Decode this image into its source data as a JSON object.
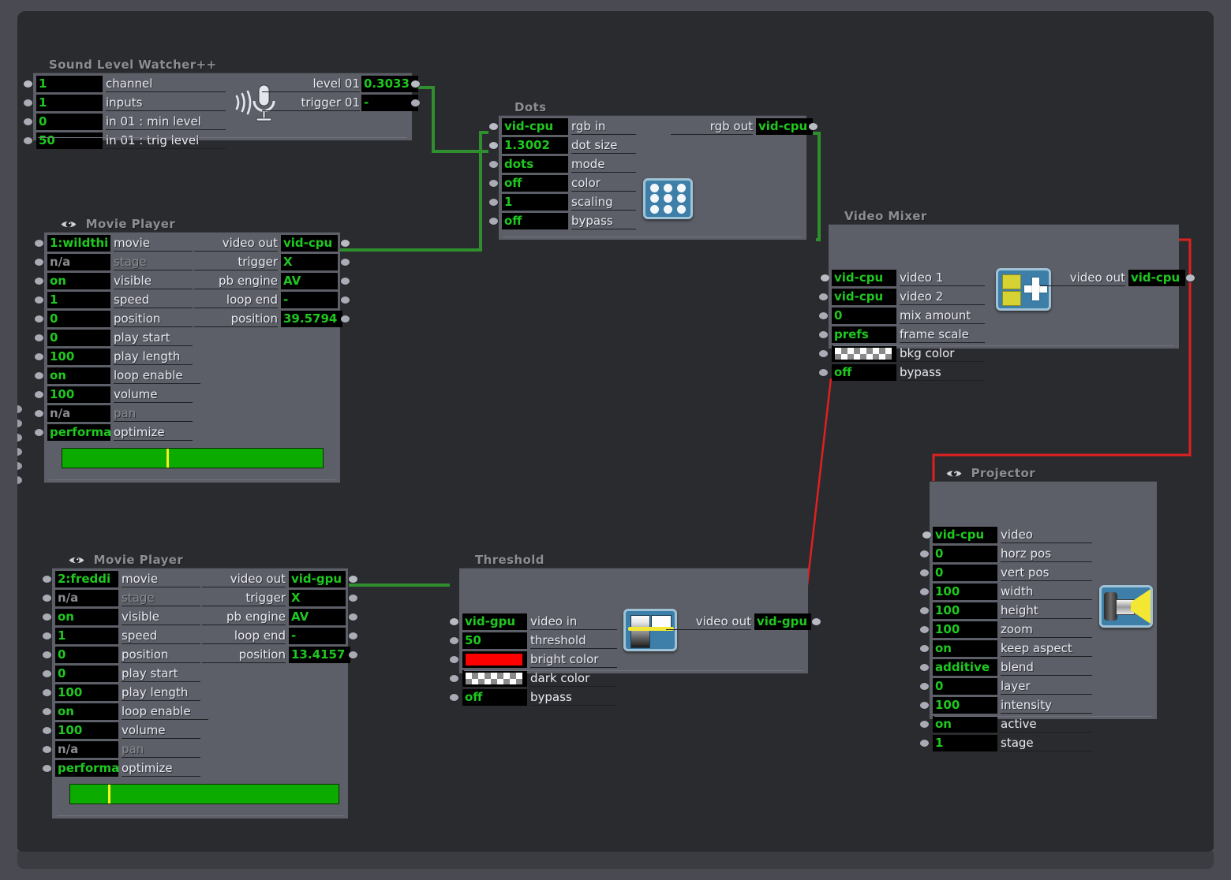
{
  "window": {
    "canvas_bg": "#2a2b2e",
    "frame_bg": "#4a4b52",
    "accent_green": "#1fc81f",
    "wire_green": "#2f8f2f",
    "wire_red": "#e02020"
  },
  "nodes": [
    {
      "id": "sound-level-watcher",
      "title": "Sound Level Watcher++",
      "icon": "microphone-icon",
      "has_eye": false,
      "inputs": [
        {
          "value": "1",
          "label": "channel"
        },
        {
          "value": "1",
          "label": "inputs"
        },
        {
          "value": "0",
          "label": "in 01 : min level"
        },
        {
          "value": "50",
          "label": "in 01 : trig level"
        }
      ],
      "outputs": [
        {
          "label": "level 01",
          "value": "0.3033",
          "connected": true
        },
        {
          "label": "trigger 01",
          "value": "-",
          "connected": false
        }
      ]
    },
    {
      "id": "dots",
      "title": "Dots",
      "icon": "dots-grid-icon",
      "has_eye": false,
      "inputs": [
        {
          "value": "vid-cpu",
          "label": "rgb in",
          "connected": true
        },
        {
          "value": "1.3002",
          "label": "dot size",
          "connected": true
        },
        {
          "value": "dots",
          "label": "mode"
        },
        {
          "value": "off",
          "label": "color"
        },
        {
          "value": "1",
          "label": "scaling"
        },
        {
          "value": "off",
          "label": "bypass"
        }
      ],
      "outputs": [
        {
          "label": "rgb out",
          "value": "vid-cpu",
          "connected": true
        }
      ]
    },
    {
      "id": "movie-player-1",
      "title": "Movie Player",
      "icon": "eye-icon",
      "has_eye": true,
      "inputs": [
        {
          "value": "1:wildthi",
          "label": "movie"
        },
        {
          "value": "n/a",
          "label": "stage",
          "dim": true
        },
        {
          "value": "on",
          "label": "visible"
        },
        {
          "value": "1",
          "label": "speed"
        },
        {
          "value": "0",
          "label": "position"
        },
        {
          "value": "0",
          "label": "play start"
        },
        {
          "value": "100",
          "label": "play length"
        },
        {
          "value": "on",
          "label": "loop enable"
        },
        {
          "value": "100",
          "label": "volume"
        },
        {
          "value": "n/a",
          "label": "pan",
          "dim": true
        },
        {
          "value": "performa",
          "label": "optimize"
        }
      ],
      "outputs": [
        {
          "label": "video out",
          "value": "vid-cpu",
          "connected": true
        },
        {
          "label": "trigger",
          "value": "X"
        },
        {
          "label": "pb engine",
          "value": "AV"
        },
        {
          "label": "loop end",
          "value": "-"
        },
        {
          "label": "position",
          "value": "39.5794"
        }
      ],
      "progress_percent": 40
    },
    {
      "id": "video-mixer",
      "title": "Video Mixer",
      "icon": "mixer-icon",
      "has_eye": false,
      "inputs": [
        {
          "value": "vid-cpu",
          "label": "video 1",
          "connected": true
        },
        {
          "value": "vid-cpu",
          "label": "video 2"
        },
        {
          "value": "0",
          "label": "mix amount"
        },
        {
          "value": "prefs",
          "label": "frame scale"
        },
        {
          "value": "",
          "label": "bkg color",
          "swatch": "checker"
        },
        {
          "value": "off",
          "label": "bypass"
        }
      ],
      "outputs": [
        {
          "label": "video out",
          "value": "vid-cpu",
          "connected": true
        }
      ]
    },
    {
      "id": "movie-player-2",
      "title": "Movie Player",
      "icon": "eye-icon",
      "has_eye": true,
      "inputs": [
        {
          "value": "2:freddi",
          "label": "movie"
        },
        {
          "value": "n/a",
          "label": "stage",
          "dim": true
        },
        {
          "value": "on",
          "label": "visible"
        },
        {
          "value": "1",
          "label": "speed"
        },
        {
          "value": "0",
          "label": "position"
        },
        {
          "value": "0",
          "label": "play start"
        },
        {
          "value": "100",
          "label": "play length"
        },
        {
          "value": "on",
          "label": "loop enable"
        },
        {
          "value": "100",
          "label": "volume"
        },
        {
          "value": "n/a",
          "label": "pan",
          "dim": true
        },
        {
          "value": "performa",
          "label": "optimize"
        }
      ],
      "outputs": [
        {
          "label": "video out",
          "value": "vid-gpu",
          "connected": true
        },
        {
          "label": "trigger",
          "value": "X"
        },
        {
          "label": "pb engine",
          "value": "AV"
        },
        {
          "label": "loop end",
          "value": "-"
        },
        {
          "label": "position",
          "value": "13.4157"
        }
      ],
      "progress_percent": 14
    },
    {
      "id": "threshold",
      "title": "Threshold",
      "icon": "threshold-icon",
      "has_eye": false,
      "inputs": [
        {
          "value": "vid-gpu",
          "label": "video in",
          "connected": true
        },
        {
          "value": "50",
          "label": "threshold"
        },
        {
          "value": "",
          "label": "bright color",
          "swatch": "red"
        },
        {
          "value": "",
          "label": "dark color",
          "swatch": "checker"
        },
        {
          "value": "off",
          "label": "bypass"
        }
      ],
      "outputs": [
        {
          "label": "video out",
          "value": "vid-gpu",
          "connected": true
        }
      ]
    },
    {
      "id": "projector",
      "title": "Projector",
      "icon": "projector-icon",
      "has_eye": true,
      "inputs": [
        {
          "value": "vid-cpu",
          "label": "video",
          "connected": true
        },
        {
          "value": "0",
          "label": "horz pos"
        },
        {
          "value": "0",
          "label": "vert pos"
        },
        {
          "value": "100",
          "label": "width"
        },
        {
          "value": "100",
          "label": "height"
        },
        {
          "value": "100",
          "label": "zoom"
        },
        {
          "value": "on",
          "label": "keep aspect"
        },
        {
          "value": "additive",
          "label": "blend"
        },
        {
          "value": "0",
          "label": "layer"
        },
        {
          "value": "100",
          "label": "intensity"
        },
        {
          "value": "on",
          "label": "active"
        },
        {
          "value": "1",
          "label": "stage"
        }
      ],
      "outputs": []
    }
  ],
  "connections": [
    {
      "from": "sound-level-watcher.level 01",
      "to": "dots.dot size",
      "color": "green"
    },
    {
      "from": "movie-player-1.video out",
      "to": "dots.rgb in",
      "color": "green"
    },
    {
      "from": "dots.rgb out",
      "to": "video-mixer.video 1",
      "color": "green"
    },
    {
      "from": "movie-player-2.video out",
      "to": "threshold.video in",
      "color": "green"
    },
    {
      "from": "threshold.video out",
      "to": "video-mixer.video 1",
      "color": "red"
    },
    {
      "from": "video-mixer.video out",
      "to": "projector.video",
      "color": "red"
    }
  ]
}
